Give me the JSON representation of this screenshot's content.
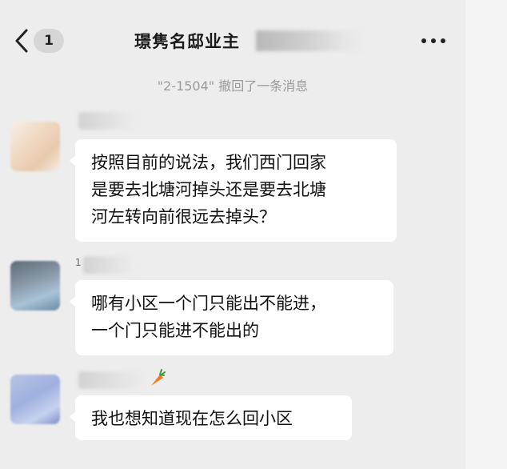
{
  "header": {
    "unread_count": "1",
    "title": "璟隽名邸业主"
  },
  "system_notice": "\"2-1504\" 撤回了一条消息",
  "messages": [
    {
      "sender_partial": "",
      "lines": [
        "按照目前的说法，我们西门回家",
        "是要去北塘河掉头还是要去北塘",
        "河左转向前很远去掉头？"
      ]
    },
    {
      "sender_partial": "1",
      "lines": [
        "哪有小区一个门只能出不能进，",
        "一个门只能进不能出的"
      ]
    },
    {
      "sender_partial": "",
      "lines": [
        "我也想知道现在怎么回小区"
      ]
    }
  ]
}
